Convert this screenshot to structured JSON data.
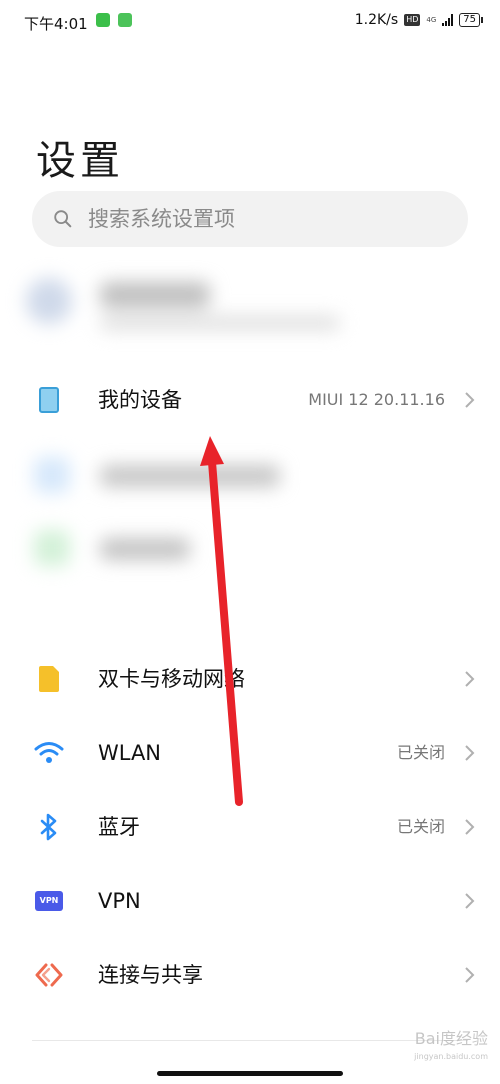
{
  "status_bar": {
    "time": "下午4:01",
    "speed": "1.2K/s",
    "hd": "HD",
    "network": "4G",
    "battery": "75"
  },
  "page": {
    "title": "设置"
  },
  "search": {
    "placeholder": "搜索系统设置项"
  },
  "my_device": {
    "label": "我的设备",
    "value": "MIUI 12 20.11.16",
    "icon": "phone-icon"
  },
  "settings": [
    {
      "label": "双卡与移动网络",
      "value": "",
      "icon": "sim-card-icon",
      "color": "#f5c02a"
    },
    {
      "label": "WLAN",
      "value": "已关闭",
      "icon": "wifi-icon",
      "color": "#2a8cf5"
    },
    {
      "label": "蓝牙",
      "value": "已关闭",
      "icon": "bluetooth-icon",
      "color": "#2a8cf5"
    },
    {
      "label": "VPN",
      "value": "",
      "icon": "vpn-icon",
      "color": "#4a5ae8",
      "icon_text": "VPN"
    },
    {
      "label": "连接与共享",
      "value": "",
      "icon": "connection-share-icon",
      "color": "#ee6a4e"
    }
  ],
  "watermark": {
    "text": "Bai度经验",
    "sub": "jingyan.baidu.com"
  },
  "colors": {
    "arrow": "#e8232a"
  }
}
